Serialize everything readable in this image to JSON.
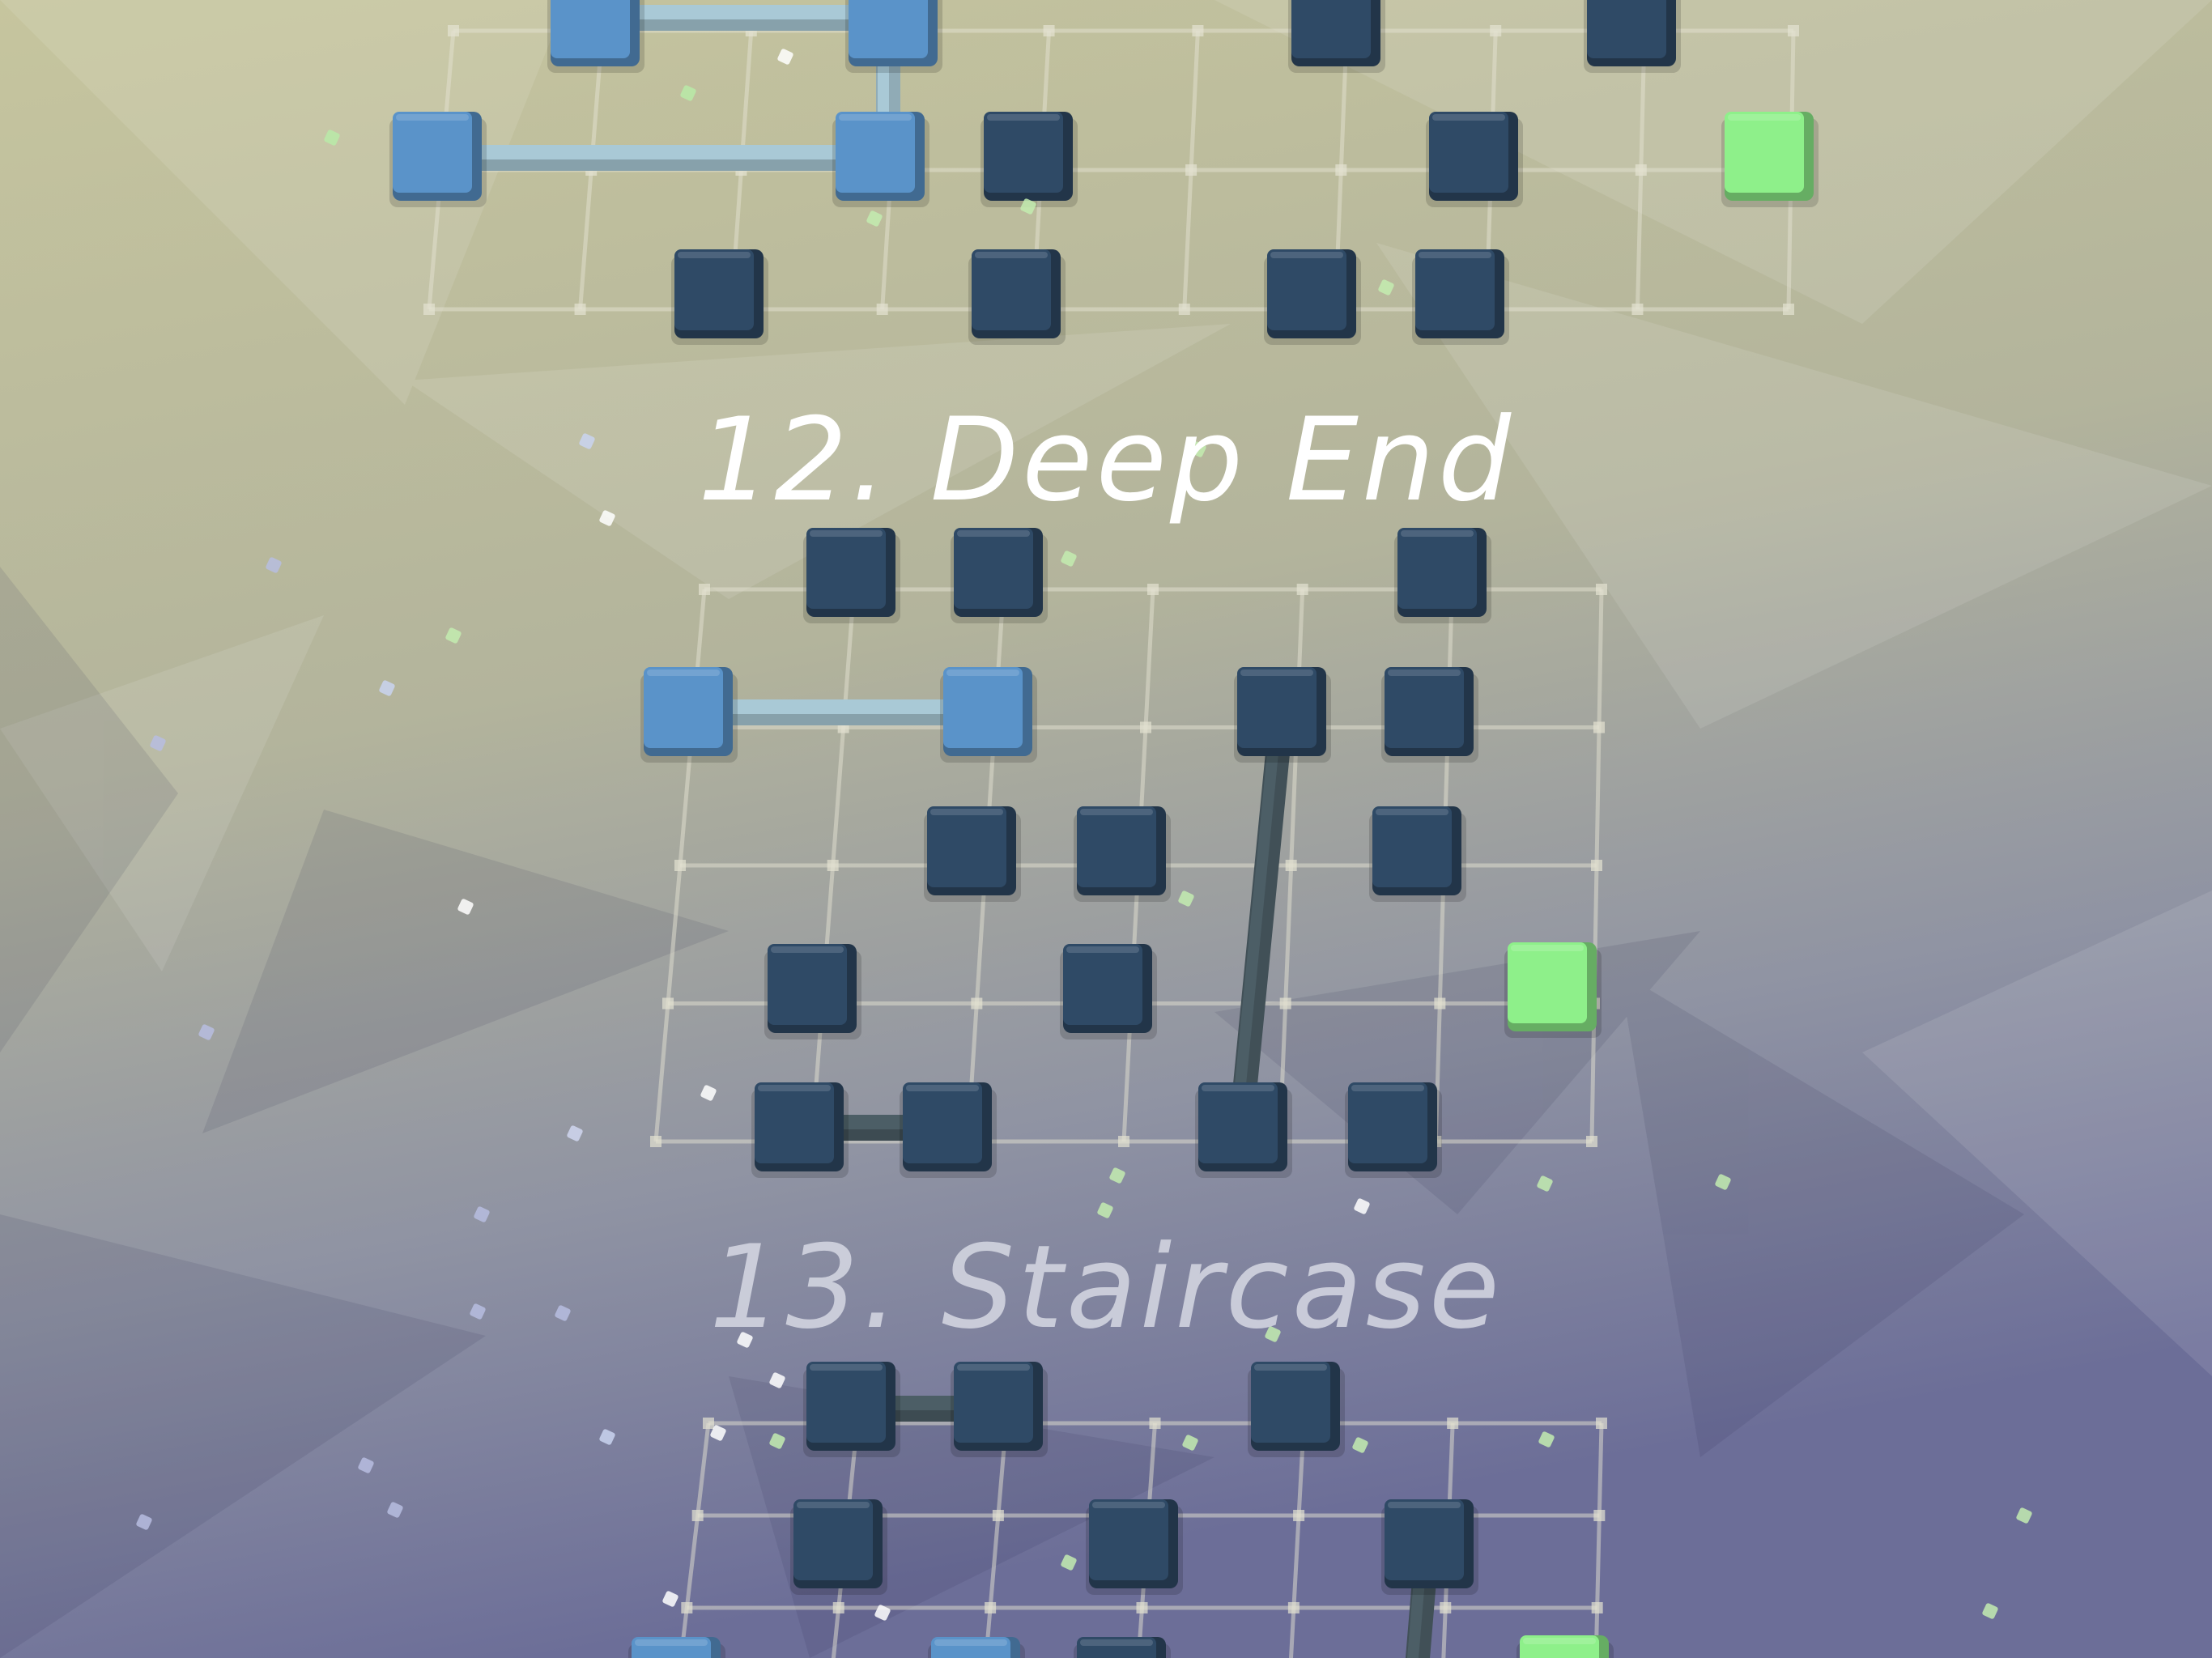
{
  "levels": [
    {
      "id": "level-11",
      "title": "",
      "active": false
    },
    {
      "id": "level-12",
      "title": "12. Deep End",
      "active": true
    },
    {
      "id": "level-13",
      "title": "13. Staircase",
      "active": false
    }
  ],
  "colors": {
    "background_top": "#c4c39c",
    "background_bottom": "#6e6f98",
    "block_dark": "#2f4a66",
    "block_blue": "#5a93c9",
    "block_green": "#8ef08a",
    "connector_light": "#a9c9d6",
    "connector_dark": "#4c5e66",
    "grid_line": "#e4e2d2"
  },
  "icons": {
    "block": "cube-block-icon",
    "goal": "goal-block-icon",
    "particle": "sparkle-particle-icon"
  }
}
